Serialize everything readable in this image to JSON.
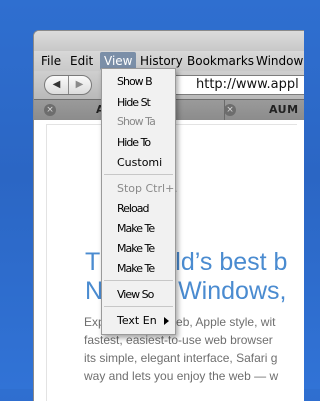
{
  "menubar": {
    "items": [
      "File",
      "Edit",
      "View",
      "History",
      "Bookmarks",
      "Window"
    ]
  },
  "toolbar": {
    "back_icon": "◀",
    "forward_icon": "▶",
    "address_favicon": "",
    "address_url": "http://www.appl"
  },
  "tabs": [
    {
      "title": "A"
    },
    {
      "title": "AUM"
    }
  ],
  "page": {
    "headline_line1": "The world’s best b",
    "headline_line2": "Now for Windows,",
    "paragraph": [
      "Experience the web, Apple style, wit",
      "fastest, easiest-to-use web browser",
      "its simple, elegant interface, Safari g",
      "way and lets you enjoy the web — w"
    ]
  },
  "view_menu": {
    "items": [
      {
        "label": "Show B",
        "disabled": false
      },
      {
        "label": "Hide St",
        "disabled": false
      },
      {
        "label": "Show Ta",
        "disabled": true
      },
      {
        "label": "Hide To",
        "disabled": false
      },
      {
        "label": "Customi",
        "disabled": false
      },
      {
        "label": "Stop Ctrl+.",
        "disabled": true
      },
      {
        "label": "Reload",
        "disabled": false
      },
      {
        "label": "Make Te",
        "disabled": false
      },
      {
        "label": "Make Te",
        "disabled": false
      },
      {
        "label": "Make Te",
        "disabled": false
      },
      {
        "label": "View So",
        "disabled": false
      },
      {
        "label": "Text En",
        "disabled": false
      }
    ]
  },
  "colors": {
    "desktop": "#2f6fd0",
    "headline": "#4a8bd0",
    "menu_highlight": "#7b8fa8"
  }
}
